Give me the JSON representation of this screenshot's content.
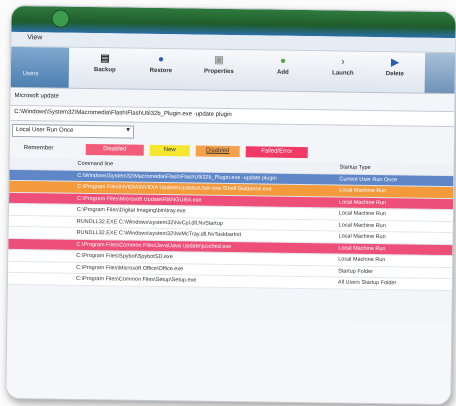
{
  "menu": {
    "label": "View"
  },
  "toolbar": {
    "left_label": "Users",
    "buttons": [
      {
        "label": "Backup",
        "icon": "backup-icon"
      },
      {
        "label": "Restore",
        "icon": "restore-icon"
      },
      {
        "label": "Properties",
        "icon": "properties-icon"
      },
      {
        "label": "Add",
        "icon": "add-icon"
      },
      {
        "label": "Launch",
        "icon": "launch-icon"
      },
      {
        "label": "Delete",
        "icon": "delete-icon"
      }
    ]
  },
  "path_label": "Microsoft update",
  "command_value": "C:\\Windows\\System32\\Macromedia\\Flash\\FlashUtil32b_Plugin.exe -update plugin",
  "filter": {
    "selected": "Local User Run Once"
  },
  "legend": {
    "label": "Remember",
    "items": [
      {
        "text": "Disabled",
        "color": "#f25c7a"
      },
      {
        "text": "New",
        "color": "#f5e630"
      },
      {
        "text": "Disabled",
        "color": "#f5a14a"
      },
      {
        "text": "Failed/Error",
        "color": "#ef3a66"
      }
    ]
  },
  "table": {
    "header": {
      "col2": "Command line",
      "col3": "Startup Type"
    },
    "rows": [
      {
        "c1": "",
        "c2": "C:\\Windows\\System32\\Macromedia\\Flash\\FlashUtil32b_Plugin.exe -update plugin",
        "c3": "Current User Run Once",
        "bg": "#5f86c7",
        "fg": "#ffffff"
      },
      {
        "c1": "",
        "c2": "C:\\Program Files\\NVIDIA\\NVIDIA Update\\UpdatusUser.exe /Shell Guidance.exe",
        "c3": "Local Machine Run",
        "bg": "#f39a3c",
        "fg": "#ffffff"
      },
      {
        "c1": "",
        "c2": "C:\\Program Files\\Microsoft Update\\RtkNGUI64.exe",
        "c3": "Local Machine Run",
        "bg": "#ee4f78",
        "fg": "#ffffff"
      },
      {
        "c1": "",
        "c2": "C:\\Program Files\\Digital Imaging\\bin\\tray.exe",
        "c3": "Local Machine Run",
        "bg": "#ffffff",
        "fg": "#333333"
      },
      {
        "c1": "",
        "c2": "RUNDLL32.EXE C:\\Windows\\system32\\NvCpl.dll,NvStartup",
        "c3": "Local Machine Run",
        "bg": "#ffffff",
        "fg": "#333333"
      },
      {
        "c1": "",
        "c2": "RUNDLL32.EXE C:\\Windows\\system32\\NvMcTray.dll,NvTaskbarInit",
        "c3": "Local Machine Run",
        "bg": "#ffffff",
        "fg": "#333333"
      },
      {
        "c1": "",
        "c2": "C:\\Program Files\\Common Files\\Java\\Java Update\\jusched.exe",
        "c3": "Local Machine Run",
        "bg": "#ee4f78",
        "fg": "#ffffff"
      },
      {
        "c1": "",
        "c2": "C:\\Program Files\\Spybot\\SpybotSD.exe",
        "c3": "Local Machine Run",
        "bg": "#ffffff",
        "fg": "#333333"
      },
      {
        "c1": "",
        "c2": "C:\\Program Files\\Microsoft Office\\Office.exe",
        "c3": "Startup Folder",
        "bg": "#ffffff",
        "fg": "#333333"
      },
      {
        "c1": "",
        "c2": "C:\\Program Files\\Common Files\\Setup\\Setup.exe",
        "c3": "All Users Startup Folder",
        "bg": "#ffffff",
        "fg": "#333333"
      }
    ]
  }
}
